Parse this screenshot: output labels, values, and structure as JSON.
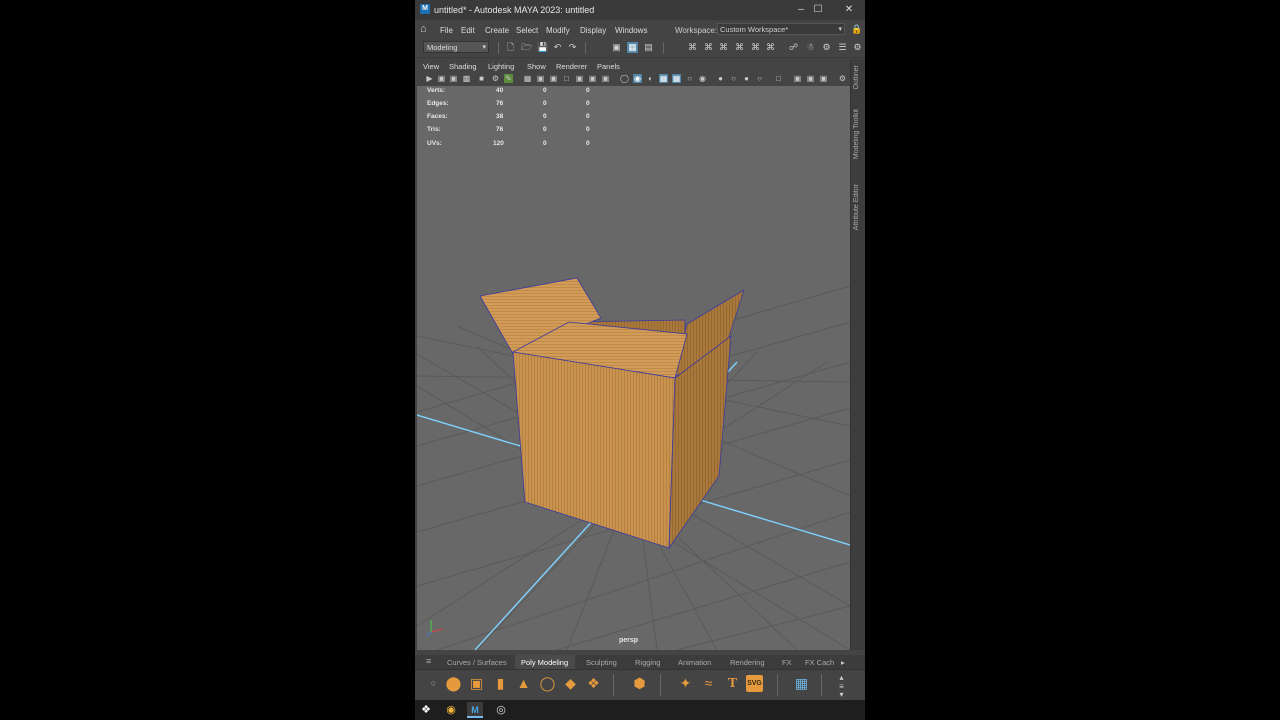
{
  "window": {
    "title": "untitled* - Autodesk MAYA 2023: untitled",
    "app_icon": "M",
    "minimize_icon": "minimize-icon",
    "maximize_icon": "maximize-icon",
    "close_icon": "close-icon"
  },
  "menubar": {
    "items": [
      "File",
      "Edit",
      "Create",
      "Select",
      "Modify",
      "Display",
      "Windows"
    ],
    "workspace_label": "Workspace:",
    "workspace_value": "Custom Workspace*"
  },
  "statusline": {
    "mode": "Modeling"
  },
  "panel": {
    "menu": [
      "View",
      "Shading",
      "Lighting",
      "Show",
      "Renderer",
      "Panels"
    ]
  },
  "hud": {
    "rows": [
      {
        "label": "Verts:",
        "v1": "40",
        "v2": "0",
        "v3": "0"
      },
      {
        "label": "Edges:",
        "v1": "76",
        "v2": "0",
        "v3": "0"
      },
      {
        "label": "Faces:",
        "v1": "38",
        "v2": "0",
        "v3": "0"
      },
      {
        "label": "Tris:",
        "v1": "76",
        "v2": "0",
        "v3": "0"
      },
      {
        "label": "UVs:",
        "v1": "120",
        "v2": "0",
        "v3": "0"
      }
    ],
    "camera": "persp"
  },
  "side_tabs": [
    "Outliner",
    "Modeling Toolkit",
    "Attribute Editor"
  ],
  "shelf": {
    "tabs": [
      "Curves / Surfaces",
      "Poly Modeling",
      "Sculpting",
      "Rigging",
      "Animation",
      "Rendering",
      "FX",
      "FX Cach"
    ],
    "active_tab": "Poly Modeling",
    "text_tool": "T",
    "svg_tool": "SVG"
  },
  "colors": {
    "accent": "#5285a6",
    "shelf_icon": "#e59a3d",
    "grid_axis": "#7fd3ff",
    "box": "#c8924f"
  }
}
